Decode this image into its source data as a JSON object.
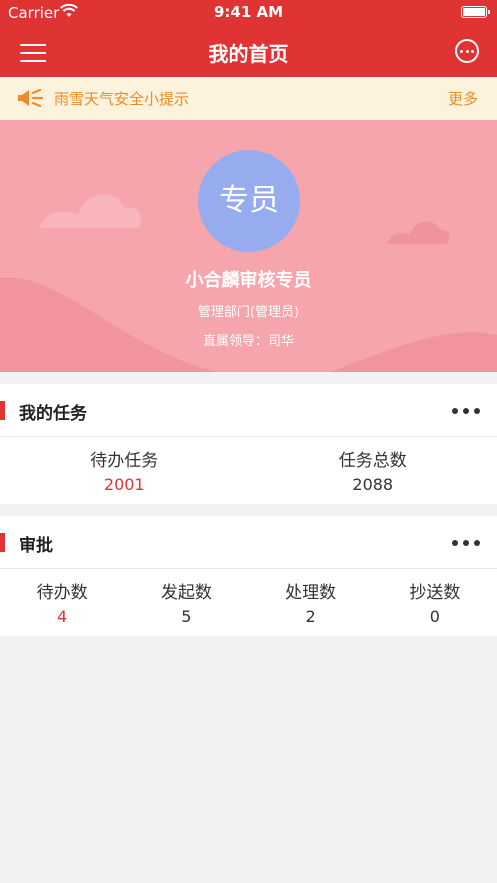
{
  "status_bar": {
    "carrier": "Carrier",
    "time": "9:41 AM"
  },
  "navbar": {
    "title": "我的首页",
    "menu_icon": "hamburger-icon",
    "more_icon": "more-circle-icon"
  },
  "notice": {
    "icon": "speaker-icon",
    "text": "雨雪天气安全小提示",
    "more": "更多",
    "color": "#ef8a27"
  },
  "profile": {
    "avatar_text": "专员",
    "name": "小合麟审核专员",
    "department": "管理部门(管理员)",
    "leader": "直属领导：司华"
  },
  "tasks": {
    "title": "我的任务",
    "items": [
      {
        "label": "待办任务",
        "value": "2001"
      },
      {
        "label": "任务总数",
        "value": "2088"
      }
    ]
  },
  "approval": {
    "title": "审批",
    "items": [
      {
        "label": "待办数",
        "value": "4"
      },
      {
        "label": "发起数",
        "value": "5"
      },
      {
        "label": "处理数",
        "value": "2"
      },
      {
        "label": "抄送数",
        "value": "0"
      }
    ]
  },
  "colors": {
    "brand": "#e03434",
    "banner": "#f6a5ad",
    "avatar": "#96acef"
  }
}
